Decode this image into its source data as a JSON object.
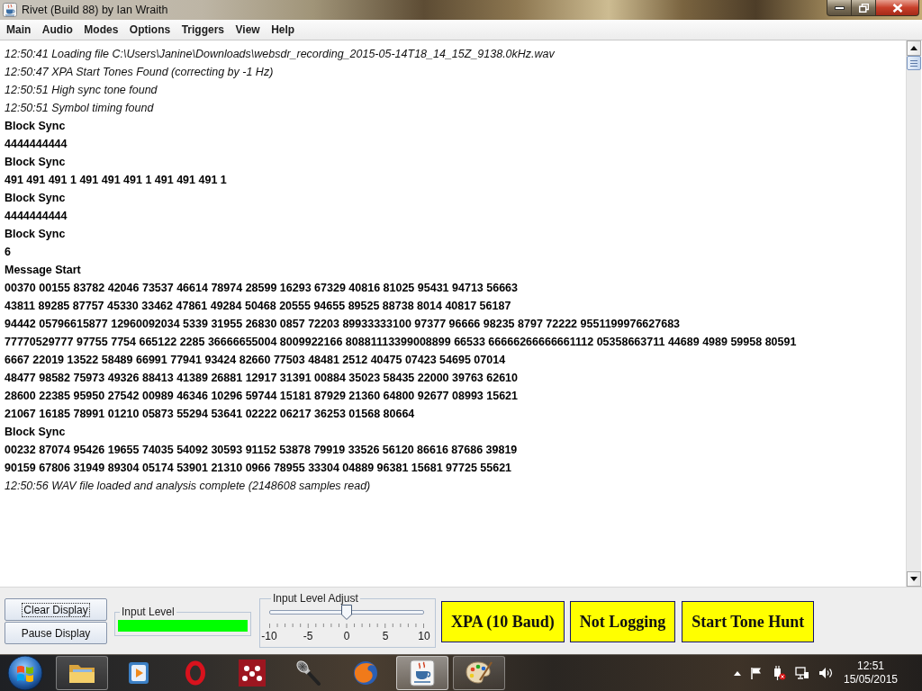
{
  "window": {
    "title": "Rivet (Build 88) by Ian Wraith"
  },
  "menu": [
    {
      "label": "Main"
    },
    {
      "label": "Audio"
    },
    {
      "label": "Modes"
    },
    {
      "label": "Options"
    },
    {
      "label": "Triggers"
    },
    {
      "label": "View"
    },
    {
      "label": "Help"
    }
  ],
  "log": [
    {
      "kind": "status",
      "text": "12:50:41 Loading file C:\\Users\\Janine\\Downloads\\websdr_recording_2015-05-14T18_14_15Z_9138.0kHz.wav"
    },
    {
      "kind": "status",
      "text": "12:50:47 XPA Start Tones Found (correcting by -1 Hz)"
    },
    {
      "kind": "status",
      "text": "12:50:51 High sync tone found"
    },
    {
      "kind": "status",
      "text": "12:50:51 Symbol timing found"
    },
    {
      "kind": "data",
      "text": "Block Sync"
    },
    {
      "kind": "data",
      "text": "4444444444"
    },
    {
      "kind": "data",
      "text": "Block Sync"
    },
    {
      "kind": "data",
      "text": "491 491 491 1 491 491 491 1 491 491 491 1"
    },
    {
      "kind": "data",
      "text": "Block Sync"
    },
    {
      "kind": "data",
      "text": "4444444444"
    },
    {
      "kind": "data",
      "text": "Block Sync"
    },
    {
      "kind": "data",
      "text": "6"
    },
    {
      "kind": "data",
      "text": "Message Start"
    },
    {
      "kind": "data",
      "text": "00370 00155 83782 42046 73537 46614 78974 28599 16293 67329 40816 81025 95431 94713 56663"
    },
    {
      "kind": "data",
      "text": "43811 89285 87757 45330 33462 47861 49284 50468 20555 94655 89525 88738 8014 40817 56187"
    },
    {
      "kind": "data",
      "text": "94442 05796615877 12960092034 5339 31955 26830 0857 72203 89933333100 97377 96666 98235 8797 72222 9551199976627683"
    },
    {
      "kind": "data",
      "text": "77770529777 97755 7754 665122 2285 36666655004 8009922166 80881113399008899 66533 66666266666661112 05358663711 44689 4989 59958 80591"
    },
    {
      "kind": "data",
      "text": "6667 22019 13522 58489 66991 77941 93424 82660 77503 48481 2512 40475 07423 54695 07014"
    },
    {
      "kind": "data",
      "text": "48477 98582 75973 49326 88413 41389 26881 12917 31391 00884 35023 58435 22000 39763 62610"
    },
    {
      "kind": "data",
      "text": "28600 22385 95950 27542 00989 46346 10296 59744 15181 87929 21360 64800 92677 08993 15621"
    },
    {
      "kind": "data",
      "text": "21067 16185 78991 01210 05873 55294 53641 02222 06217 36253 01568 80664"
    },
    {
      "kind": "data",
      "text": "Block Sync"
    },
    {
      "kind": "data",
      "text": "00232 87074 95426 19655 74035 54092 30593 91152 53878 79919 33526 56120 86616 87686 39819"
    },
    {
      "kind": "data",
      "text": "90159 67806 31949 89304 05174 53901 21310 0966 78955 33304 04889 96381 15681 97725 55621"
    },
    {
      "kind": "status",
      "text": "12:50:56 WAV file loaded and analysis complete (2148608 samples read)"
    }
  ],
  "controls": {
    "buttons": [
      {
        "label": "Clear Display",
        "focused": true
      },
      {
        "label": "Pause Display",
        "focused": false
      }
    ],
    "input_level": {
      "title": "Input Level",
      "level": 1.0
    },
    "input_level_adjust": {
      "title": "Input Level Adjust",
      "level": 0.5,
      "tick_labels": [
        "-10",
        "-5",
        "0",
        "5",
        "10"
      ]
    },
    "status_buttons": [
      {
        "label": "XPA (10 Baud)"
      },
      {
        "label": "Not Logging"
      },
      {
        "label": "Start Tone Hunt"
      }
    ]
  },
  "taskbar": {
    "apps": [
      {
        "kind": "folder",
        "open": true,
        "selected": false
      },
      {
        "kind": "media",
        "open": false,
        "selected": false
      },
      {
        "kind": "ring",
        "open": false,
        "selected": false
      },
      {
        "kind": "dots",
        "open": false,
        "selected": false
      },
      {
        "kind": "microphone",
        "open": false,
        "selected": false
      },
      {
        "kind": "globe",
        "open": false,
        "selected": false
      },
      {
        "kind": "cup",
        "open": true,
        "selected": true
      },
      {
        "kind": "palette",
        "open": true,
        "selected": false
      }
    ],
    "clock": {
      "time": "12:51",
      "date": "15/05/2015"
    }
  }
}
